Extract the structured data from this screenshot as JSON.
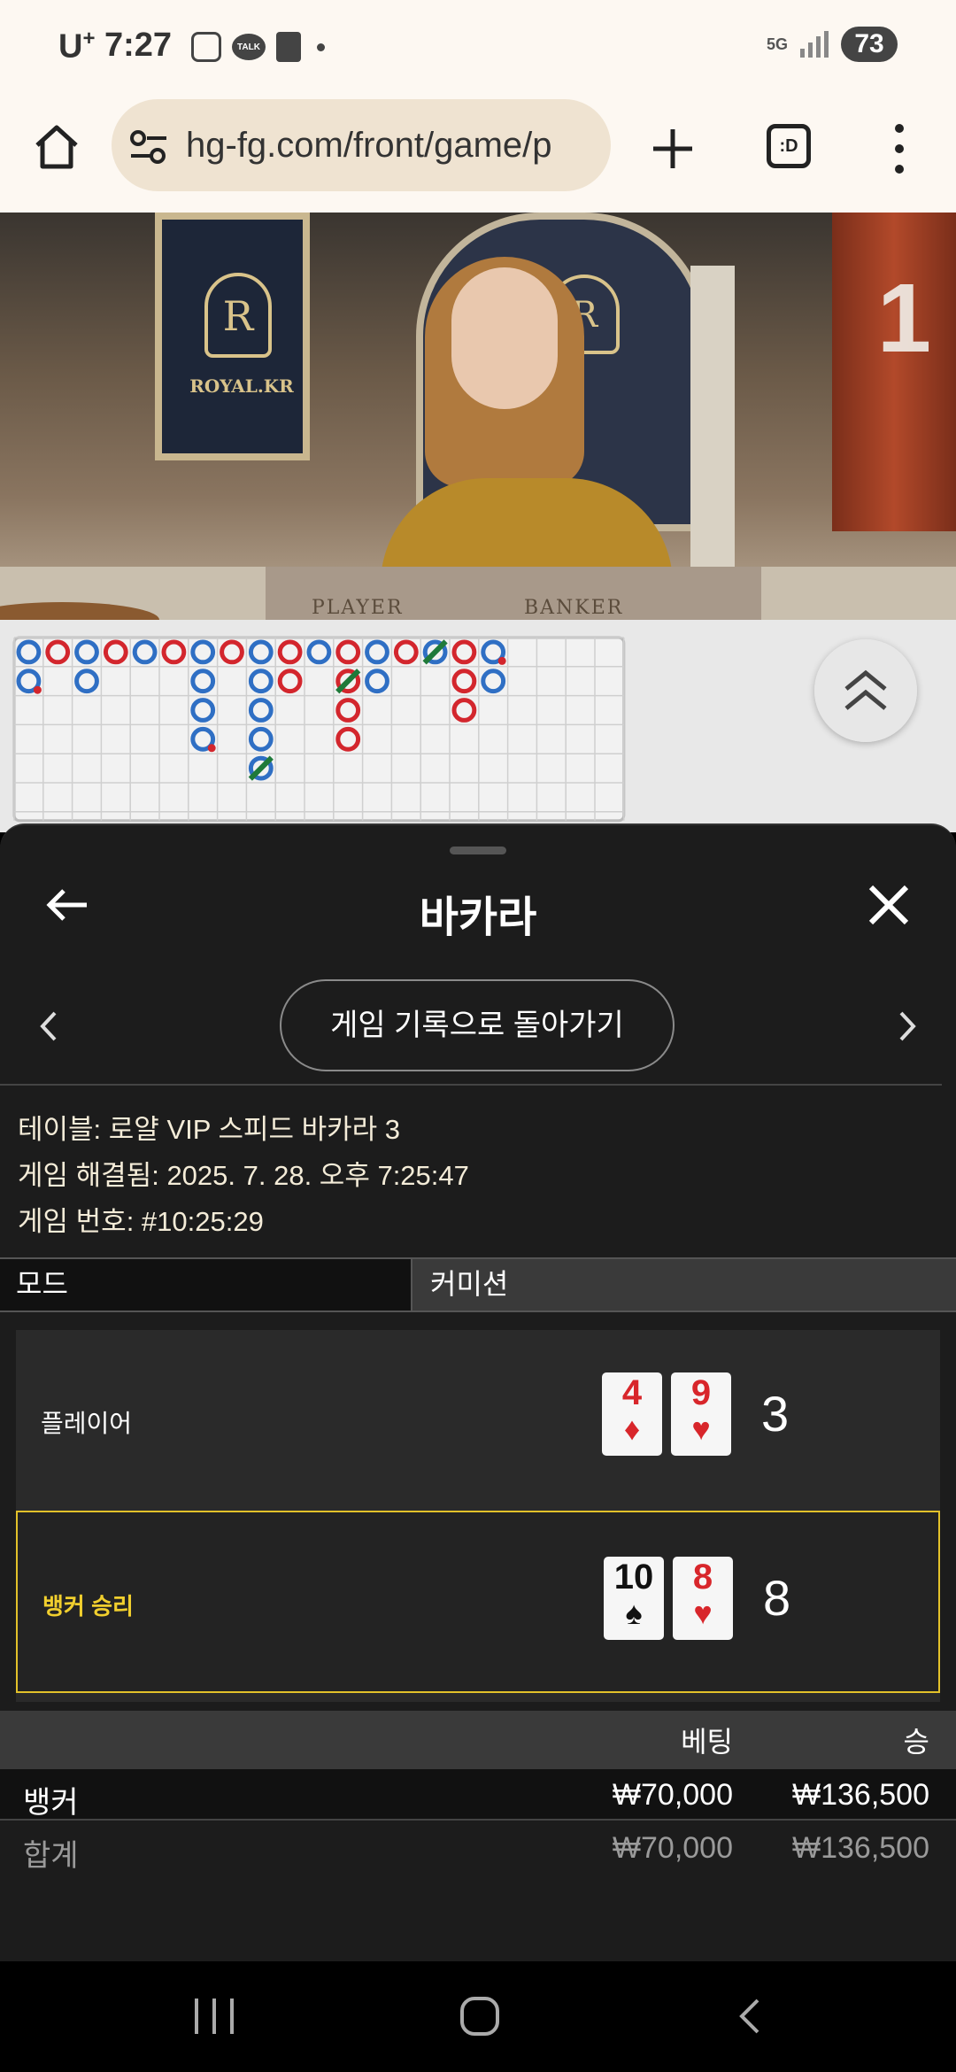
{
  "status_bar": {
    "carrier": "U",
    "carrier_sup": "+",
    "time": "7:27",
    "talk_label": "TALK",
    "network": "5G",
    "battery": "73"
  },
  "browser": {
    "url": "hg-fg.com/front/game/p",
    "tabs_label": ":D"
  },
  "video": {
    "left_logo_text": "ROYAL.KR",
    "crest_letter": "R",
    "table_player": "PLAYER",
    "table_banker": "BANKER",
    "table_number": "1"
  },
  "roadmap": {
    "rows": 6,
    "cols": 21,
    "columns": [
      {
        "col": 0,
        "cells": [
          {
            "r": 0,
            "c": "blue"
          },
          {
            "r": 1,
            "c": "blue",
            "pair": "red"
          }
        ]
      },
      {
        "col": 1,
        "cells": [
          {
            "r": 0,
            "c": "red"
          }
        ]
      },
      {
        "col": 2,
        "cells": [
          {
            "r": 0,
            "c": "blue"
          },
          {
            "r": 1,
            "c": "blue"
          }
        ]
      },
      {
        "col": 3,
        "cells": [
          {
            "r": 0,
            "c": "red"
          }
        ]
      },
      {
        "col": 4,
        "cells": [
          {
            "r": 0,
            "c": "blue"
          }
        ]
      },
      {
        "col": 5,
        "cells": [
          {
            "r": 0,
            "c": "red"
          }
        ]
      },
      {
        "col": 6,
        "cells": [
          {
            "r": 0,
            "c": "blue"
          },
          {
            "r": 1,
            "c": "blue"
          },
          {
            "r": 2,
            "c": "blue"
          },
          {
            "r": 3,
            "c": "blue",
            "pair": "red"
          }
        ]
      },
      {
        "col": 7,
        "cells": [
          {
            "r": 0,
            "c": "red"
          }
        ]
      },
      {
        "col": 8,
        "cells": [
          {
            "r": 0,
            "c": "blue"
          },
          {
            "r": 1,
            "c": "blue"
          },
          {
            "r": 2,
            "c": "blue"
          },
          {
            "r": 3,
            "c": "blue"
          },
          {
            "r": 4,
            "c": "blue",
            "tie": true
          }
        ]
      },
      {
        "col": 9,
        "cells": [
          {
            "r": 0,
            "c": "red"
          },
          {
            "r": 1,
            "c": "red"
          }
        ]
      },
      {
        "col": 10,
        "cells": [
          {
            "r": 0,
            "c": "blue"
          }
        ]
      },
      {
        "col": 11,
        "cells": [
          {
            "r": 0,
            "c": "red"
          },
          {
            "r": 1,
            "c": "red",
            "tie": true
          },
          {
            "r": 2,
            "c": "red"
          },
          {
            "r": 3,
            "c": "red"
          }
        ]
      },
      {
        "col": 12,
        "cells": [
          {
            "r": 0,
            "c": "blue"
          },
          {
            "r": 1,
            "c": "blue"
          }
        ]
      },
      {
        "col": 13,
        "cells": [
          {
            "r": 0,
            "c": "red"
          }
        ]
      },
      {
        "col": 14,
        "cells": [
          {
            "r": 0,
            "c": "blue",
            "tie": true
          }
        ]
      },
      {
        "col": 15,
        "cells": [
          {
            "r": 0,
            "c": "red"
          },
          {
            "r": 1,
            "c": "red"
          },
          {
            "r": 2,
            "c": "red"
          }
        ]
      },
      {
        "col": 16,
        "cells": [
          {
            "r": 0,
            "c": "blue",
            "pair": "red"
          },
          {
            "r": 1,
            "c": "blue"
          }
        ]
      }
    ]
  },
  "sheet": {
    "title": "바카라",
    "return_button": "게임 기록으로 돌아가기",
    "table_info": "테이블: 로얄 VIP 스피드 바카라 3",
    "resolved_info": "게임 해결됨: 2025. 7. 28. 오후 7:25:47",
    "game_number_info": "게임 번호: #10:25:29",
    "mode_label": "모드",
    "mode_value": "커미션",
    "player": {
      "label": "플레이어",
      "score": "3",
      "cards": [
        {
          "rank": "4",
          "suit": "♦",
          "color": "red"
        },
        {
          "rank": "9",
          "suit": "♥",
          "color": "red"
        }
      ]
    },
    "banker": {
      "label": "뱅커 승리",
      "score": "8",
      "cards": [
        {
          "rank": "10",
          "suit": "♠",
          "color": "black"
        },
        {
          "rank": "8",
          "suit": "♥",
          "color": "red"
        }
      ]
    },
    "bets": {
      "head_bet": "베팅",
      "head_win": "승",
      "rows": [
        {
          "name": "뱅커",
          "bet": "₩70,000",
          "win": "₩136,500"
        },
        {
          "name": "합계",
          "bet": "₩70,000",
          "win": "₩136,500"
        }
      ]
    }
  },
  "colors": {
    "accent_gold": "#e2c12a",
    "road_blue": "#2f6fc4",
    "road_red": "#d3262d",
    "tie_green": "#1f7a3a"
  }
}
